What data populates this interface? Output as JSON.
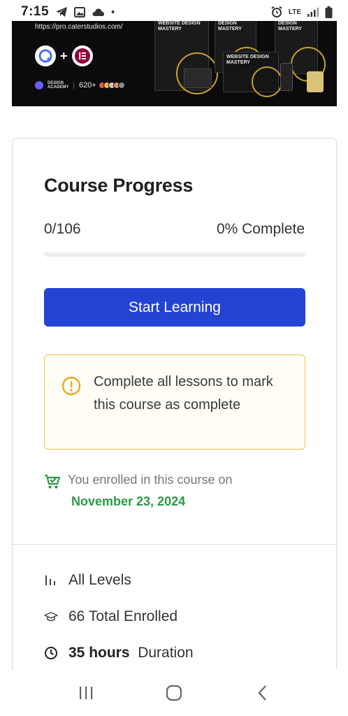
{
  "status_bar": {
    "time": "7:15",
    "network": "LTE"
  },
  "banner": {
    "url": "https://pro.caterstudios.com/",
    "academy_line1": "DESIGN",
    "academy_line2": "ACADEMY",
    "enrolled_count": "620+",
    "mockup_titles": [
      "WEBSITE DESIGN MASTERY",
      "DESIGN MASTERY",
      "DESIGN MASTERY",
      "WEBSITE DESIGN MASTERY"
    ]
  },
  "card": {
    "title": "Course Progress",
    "progress_count": "0/106",
    "progress_percent_label": "0% Complete",
    "progress_fraction": 0,
    "start_button_label": "Start Learning",
    "notice_text": "Complete all lessons to mark this course as complete",
    "enroll_text": "You enrolled in this course on",
    "enroll_date": "November 23, 2024",
    "meta": {
      "level": "All Levels",
      "enrolled": "66 Total Enrolled",
      "duration_value": "35 hours",
      "duration_label": "Duration"
    }
  },
  "colors": {
    "primary": "#2443d3",
    "warning_border": "#f0c04a",
    "success_text": "#2b9a45"
  }
}
